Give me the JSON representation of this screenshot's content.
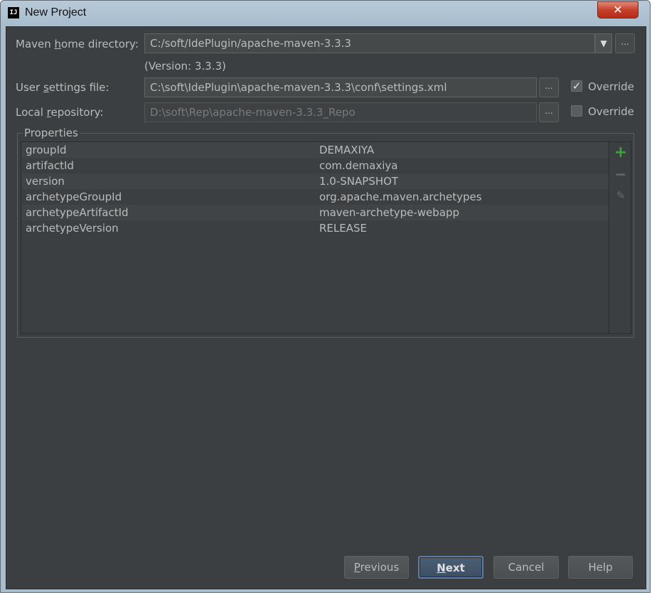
{
  "window": {
    "title": "New Project",
    "app_icon": "IJ",
    "close_icon": "close-icon"
  },
  "form": {
    "maven_home": {
      "label_prefix": "Maven ",
      "label_mnemonic": "h",
      "label_suffix": "ome directory:",
      "value": "C:/soft/IdePlugin/apache-maven-3.3.3",
      "browse": "..."
    },
    "version_note": "(Version: 3.3.3)",
    "user_settings": {
      "label_prefix": "User ",
      "label_mnemonic": "s",
      "label_suffix": "ettings file:",
      "value": "C:\\soft\\IdePlugin\\apache-maven-3.3.3\\conf\\settings.xml",
      "browse": "...",
      "override_label": "Override",
      "override_checked": true
    },
    "local_repo": {
      "label_prefix": "Local ",
      "label_mnemonic": "r",
      "label_suffix": "epository:",
      "value": "D:\\soft\\Rep\\apache-maven-3.3.3_Repo",
      "browse": "...",
      "override_label": "Override",
      "override_checked": false
    }
  },
  "properties": {
    "title": "Properties",
    "rows": [
      {
        "key": "groupId",
        "value": "DEMAXIYA"
      },
      {
        "key": "artifactId",
        "value": "com.demaxiya"
      },
      {
        "key": "version",
        "value": "1.0-SNAPSHOT"
      },
      {
        "key": "archetypeGroupId",
        "value": "org.apache.maven.archetypes"
      },
      {
        "key": "archetypeArtifactId",
        "value": "maven-archetype-webapp"
      },
      {
        "key": "archetypeVersion",
        "value": "RELEASE"
      }
    ],
    "toolbar": {
      "add": "+",
      "remove": "−",
      "edit": "✎"
    }
  },
  "buttons": {
    "previous_mnemonic": "P",
    "previous_rest": "revious",
    "next_mnemonic": "N",
    "next_rest": "ext",
    "cancel": "Cancel",
    "help": "Help"
  }
}
